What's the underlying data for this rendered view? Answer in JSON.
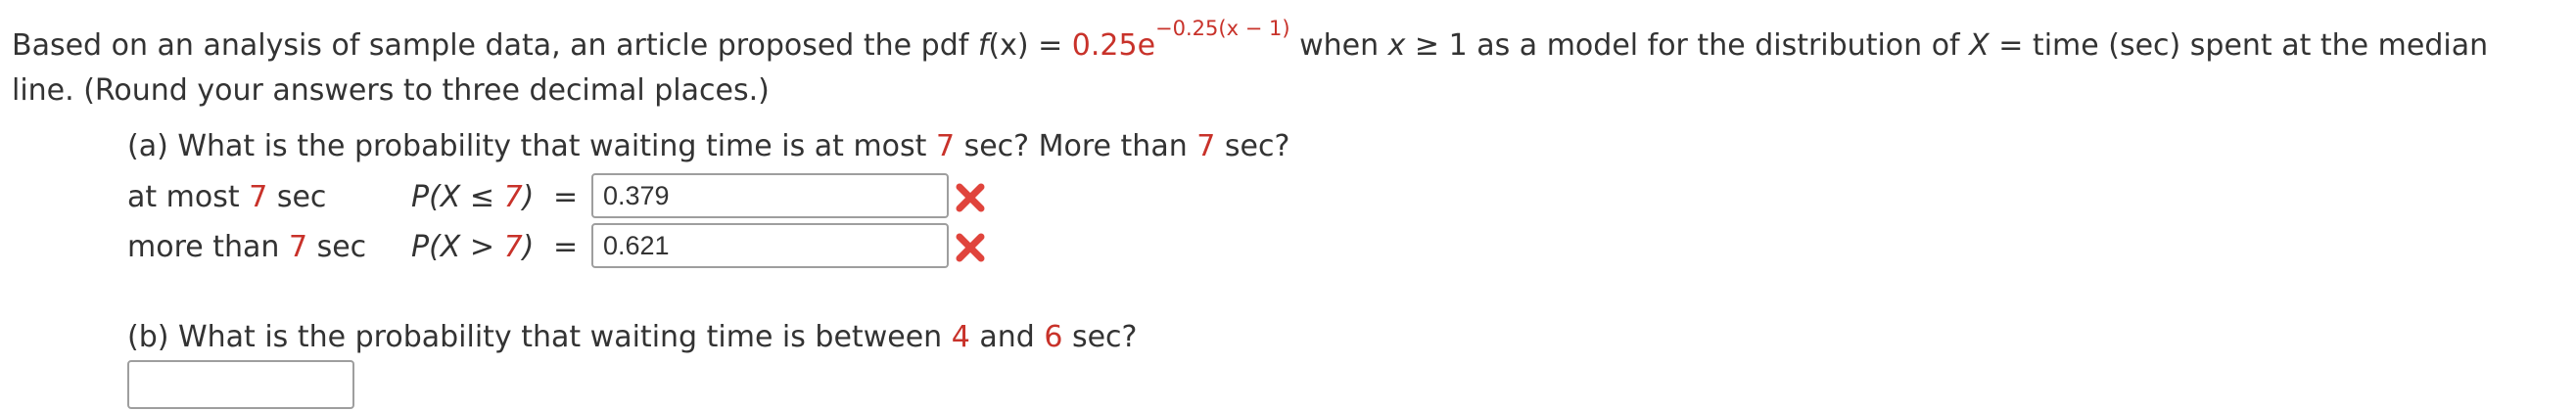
{
  "intro": {
    "part1": "Based on an analysis of sample data, an article proposed the pdf ",
    "pdf_name": "f",
    "pdf_arg": "(x) = ",
    "coef": "0.25e",
    "exponent": "−0.25(x − 1)",
    "part2": " when ",
    "cond_var": "x",
    "cond": " ≥ 1 as a model for the distribution of ",
    "rv": "X",
    "part3": " = time (sec) spent at the median line. (Round your answers to three decimal places.)"
  },
  "part_a": {
    "q_pre": "(a) What is the probability that waiting time is at most ",
    "q_n1": "7",
    "q_mid": " sec? More than ",
    "q_n2": "7",
    "q_post": " sec?",
    "rows": [
      {
        "label_pre": "at most ",
        "label_n": "7",
        "label_post": " sec",
        "expr_pre": "P(X ≤ ",
        "expr_n": "7",
        "expr_post": ")",
        "eq": "=",
        "value": "0.379",
        "status_icon": "incorrect-x-icon"
      },
      {
        "label_pre": "more than ",
        "label_n": "7",
        "label_post": " sec",
        "expr_pre": "P(X > ",
        "expr_n": "7",
        "expr_post": ")",
        "eq": "=",
        "value": "0.621",
        "status_icon": "incorrect-x-icon"
      }
    ]
  },
  "part_b": {
    "q_pre": "(b) What is the probability that waiting time is between ",
    "q_n1": "4",
    "q_mid": " and ",
    "q_n2": "6",
    "q_post": " sec?",
    "value": ""
  },
  "colors": {
    "highlight": "#c8322a",
    "text": "#333333",
    "incorrect": "#e0443c",
    "field_border": "#9e9e9e"
  }
}
